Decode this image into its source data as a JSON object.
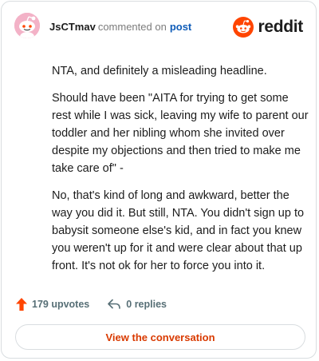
{
  "header": {
    "username": "JsCTmav",
    "action": "commented on",
    "target": "post",
    "logo_text": "reddit",
    "logo_icon": "reddit-snoo-icon",
    "avatar_icon": "snoo-avatar-icon"
  },
  "comment": {
    "paragraphs": [
      "NTA, and definitely a misleading headline.",
      "Should have been \"AITA for trying to get some rest while I was sick, leaving my wife to parent our toddler and her nibling whom she invited over despite my objections and then tried to make me take care of\" -",
      "No, that's kind of long and awkward, better the way you did it. But still, NTA. You didn't sign up to babysit someone else's kid, and in fact you knew you weren't up for it and were clear about that up front. It's not ok for her to force you into it."
    ]
  },
  "footer": {
    "upvotes": "179 upvotes",
    "replies": "0 replies",
    "upvote_icon": "upvote-arrow-icon",
    "reply_icon": "reply-arrow-icon"
  },
  "cta": {
    "label": "View the conversation"
  },
  "colors": {
    "accent": "#d93a00",
    "link": "#0f5cb8",
    "upvote": "#ff4500",
    "avatar_bg": "#f3b2c7"
  }
}
